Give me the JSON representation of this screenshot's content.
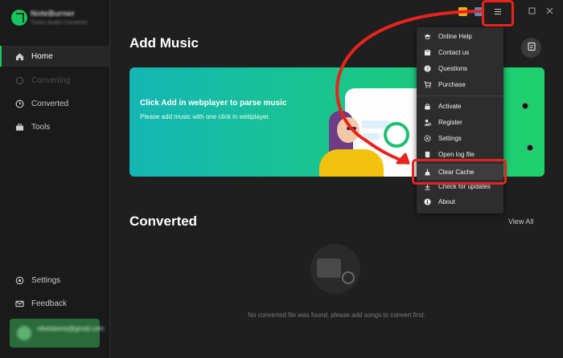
{
  "app": {
    "name": "NoteBurner",
    "subtitle": "Tunes Audio Converter"
  },
  "sidebar": {
    "items": [
      {
        "label": "Home",
        "icon": "home-icon",
        "state": "active"
      },
      {
        "label": "Converting",
        "icon": "converting-icon",
        "state": "disabled"
      },
      {
        "label": "Converted",
        "icon": "clock-icon",
        "state": "normal"
      },
      {
        "label": "Tools",
        "icon": "toolbox-icon",
        "state": "normal"
      }
    ],
    "bottom": [
      {
        "label": "Settings",
        "icon": "gear-icon"
      },
      {
        "label": "Feedback",
        "icon": "mail-icon"
      }
    ],
    "user": {
      "email": "nikelaberia@gmail.com"
    }
  },
  "main": {
    "add_music_title": "Add Music",
    "banner": {
      "title": "Click Add in webplayer to parse music",
      "subtitle": "Please add music with one click in webplayer."
    },
    "converted_title": "Converted",
    "view_all": "View All",
    "empty_text": "No converted file was found, please add songs to convert first."
  },
  "window": {
    "controls": [
      "gift-icon",
      "menu-icon",
      "minimize-icon",
      "maximize-icon",
      "close-icon"
    ]
  },
  "menu": {
    "items": [
      {
        "label": "Online Help",
        "icon": "graduation-icon"
      },
      {
        "label": "Contact us",
        "icon": "phone-icon"
      },
      {
        "label": "Questions",
        "icon": "question-icon"
      },
      {
        "label": "Purchase",
        "icon": "cart-icon"
      },
      {
        "label": "Activate",
        "icon": "lock-icon"
      },
      {
        "label": "Register",
        "icon": "register-icon"
      },
      {
        "label": "Settings",
        "icon": "gear-icon"
      },
      {
        "label": "Open log file",
        "icon": "file-icon"
      },
      {
        "label": "Clear Cache",
        "icon": "broom-icon"
      },
      {
        "label": "Check for updates",
        "icon": "update-icon"
      },
      {
        "label": "About",
        "icon": "info-icon"
      }
    ]
  },
  "colors": {
    "accent": "#19c763",
    "annotation": "#e8231e"
  }
}
